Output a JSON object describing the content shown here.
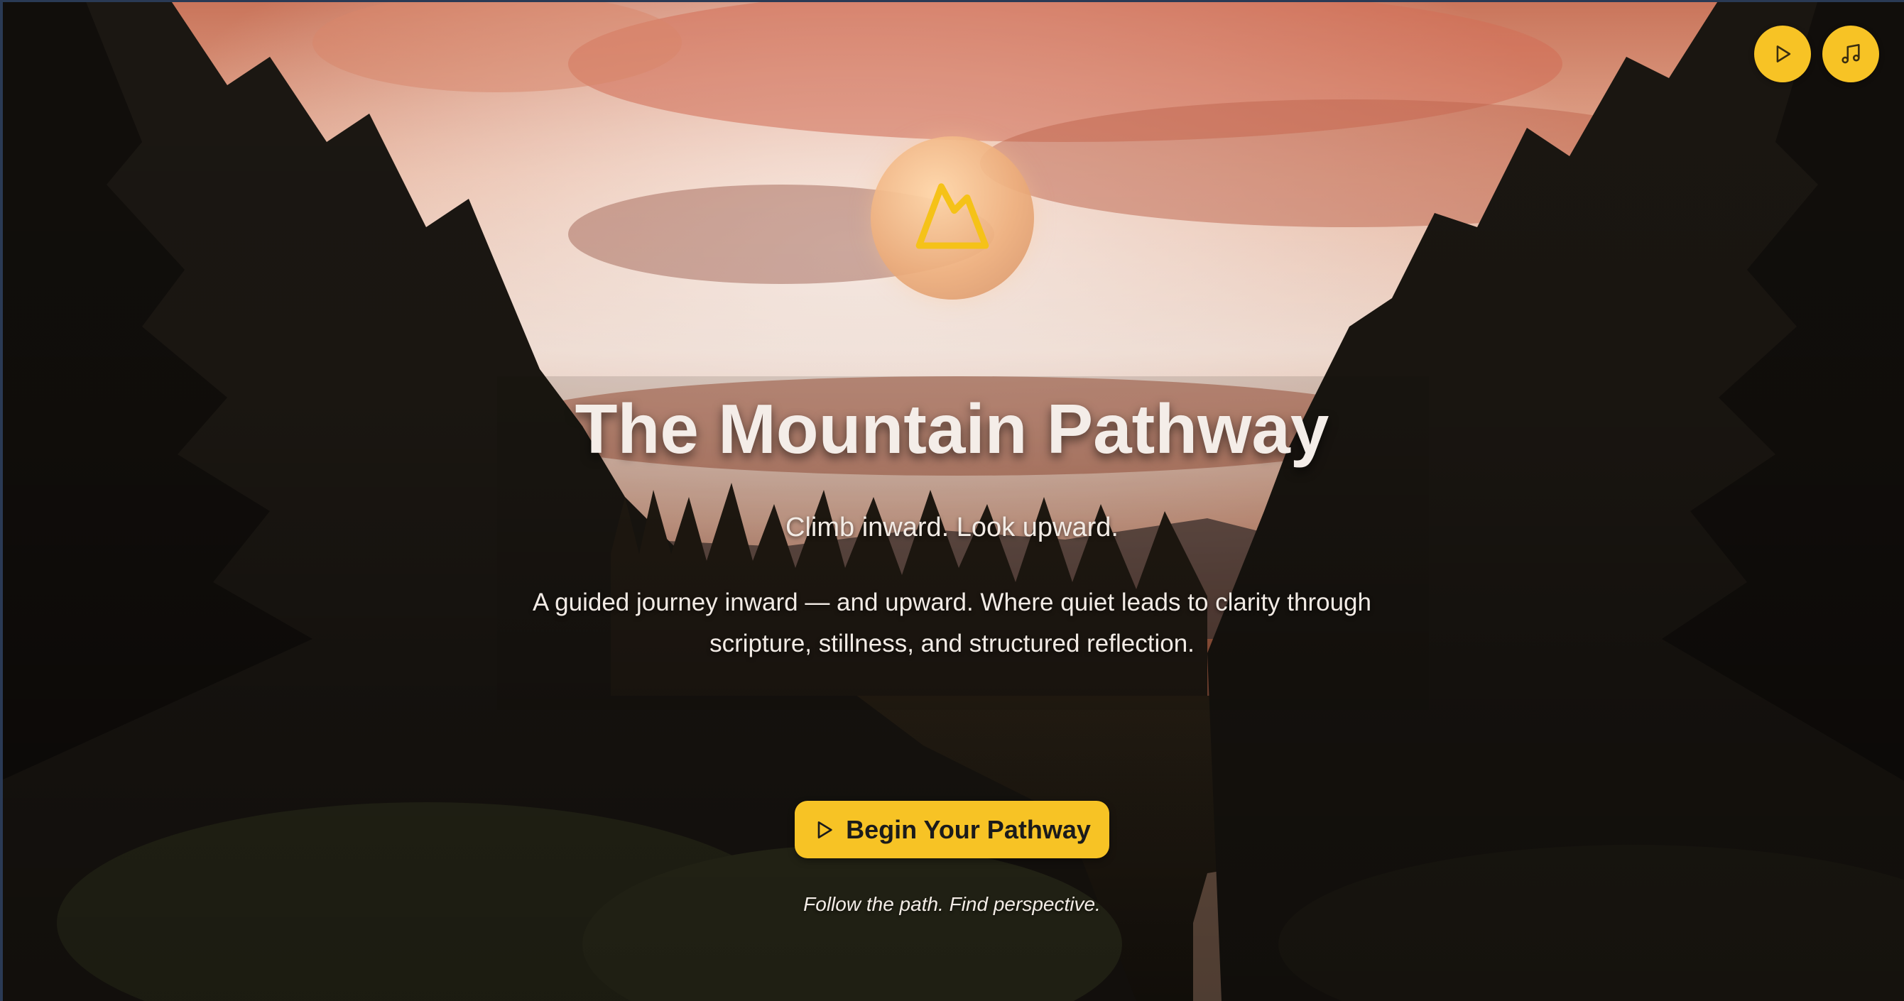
{
  "colors": {
    "accent": "#f7c325",
    "title_text": "#f4ede8",
    "sky_glow": "#f2a07a",
    "forest_dark": "#1a140f"
  },
  "controls": {
    "play_icon": "play-icon",
    "music_icon": "music-note-icon"
  },
  "logo": {
    "icon": "mountain-icon"
  },
  "hero": {
    "title": "The Mountain Pathway",
    "tagline": "Climb inward. Look upward.",
    "description": "A guided journey inward — and upward. Where quiet leads to clarity through scripture, stillness, and structured reflection."
  },
  "cta": {
    "label": "Begin Your Pathway",
    "icon": "play-icon"
  },
  "footnote": "Follow the path. Find perspective."
}
